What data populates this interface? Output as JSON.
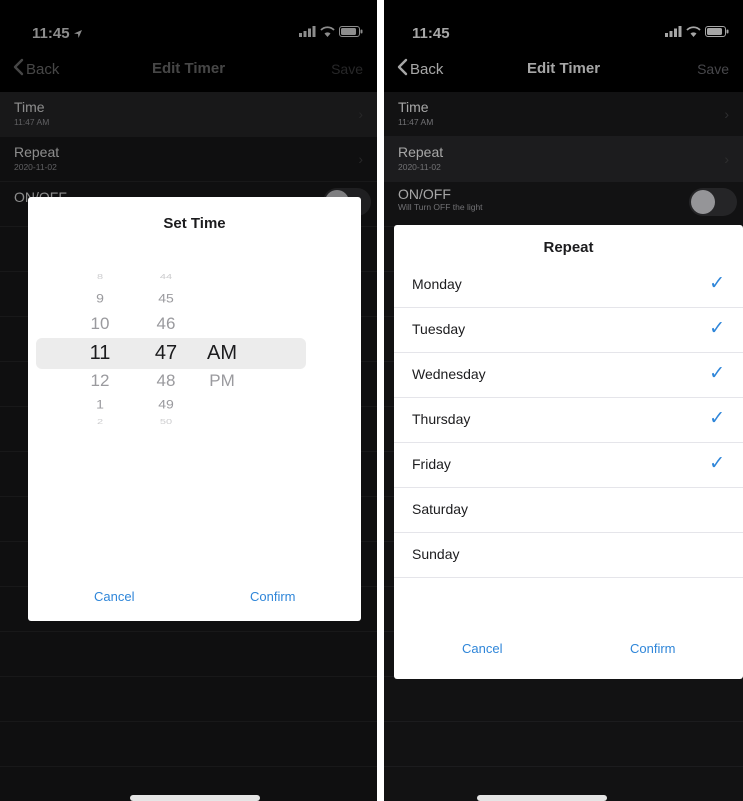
{
  "left_phone": {
    "status_time": "11:45",
    "nav": {
      "back_label": "Back",
      "title": "Edit Timer",
      "save_label": "Save"
    },
    "rows": [
      {
        "title": "Time",
        "subtitle": "11:47 AM"
      },
      {
        "title": "Repeat",
        "subtitle": "2020-11-02"
      },
      {
        "title": "ON/OFF"
      }
    ],
    "dialog": {
      "title": "Set Time",
      "hours": [
        "8",
        "9",
        "10",
        "11",
        "12",
        "1",
        "2"
      ],
      "minutes": [
        "44",
        "45",
        "46",
        "47",
        "48",
        "49",
        "50"
      ],
      "ampm": [
        "AM",
        "PM"
      ],
      "selected": {
        "hour": "11",
        "minute": "47",
        "ampm": "AM"
      },
      "cancel_label": "Cancel",
      "confirm_label": "Confirm"
    }
  },
  "right_phone": {
    "status_time": "11:45",
    "nav": {
      "back_label": "Back",
      "title": "Edit Timer",
      "save_label": "Save"
    },
    "rows": [
      {
        "title": "Time",
        "subtitle": "11:47 AM"
      },
      {
        "title": "Repeat",
        "subtitle": "2020-11-02"
      },
      {
        "title": "ON/OFF",
        "subtitle": "Will Turn OFF the light"
      }
    ],
    "onoff_state": false,
    "dialog": {
      "title": "Repeat",
      "days": [
        {
          "label": "Monday",
          "checked": true
        },
        {
          "label": "Tuesday",
          "checked": true
        },
        {
          "label": "Wednesday",
          "checked": true
        },
        {
          "label": "Thursday",
          "checked": true
        },
        {
          "label": "Friday",
          "checked": true
        },
        {
          "label": "Saturday",
          "checked": false
        },
        {
          "label": "Sunday",
          "checked": false
        }
      ],
      "check_glyph": "✓",
      "cancel_label": "Cancel",
      "confirm_label": "Confirm"
    }
  },
  "colors": {
    "accent": "#2f86d9",
    "background_dark": "#1c1c1e",
    "dialog_bg": "#ffffff",
    "selection_band": "#ececec"
  }
}
